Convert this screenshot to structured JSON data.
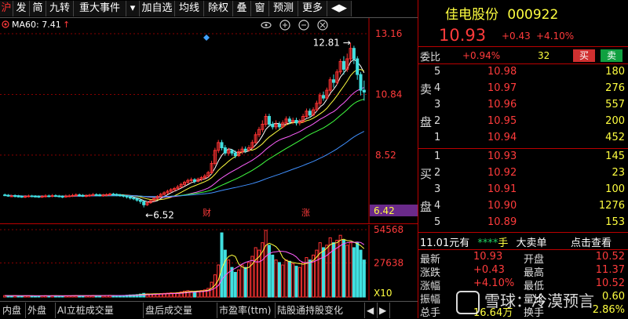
{
  "toolbar": {
    "items": [
      "沪",
      "发",
      "简",
      "九转",
      "重大事件",
      "▾",
      "加自选",
      "均线",
      "除权",
      "叠",
      "窗",
      "预测",
      "更多",
      "◀▶"
    ]
  },
  "indicator": {
    "icon": "target-icon",
    "ma60_label": "MA60: 7.41",
    "ma60_arrow": "↑"
  },
  "chart_icons": [
    "eye-icon",
    "plus-icon",
    "minus-icon",
    "close-icon"
  ],
  "chart_data": [
    {
      "type": "candlestick",
      "title": "",
      "y_ticks": [
        "13.16",
        "10.84",
        "8.52",
        "6.42"
      ],
      "ylim": [
        6.42,
        13.16
      ],
      "annotations": [
        {
          "text": "12.81",
          "kind": "high"
        },
        {
          "text": "6.52",
          "kind": "low"
        },
        {
          "text": "财",
          "kind": "event"
        },
        {
          "text": "涨",
          "kind": "event"
        }
      ],
      "series_colors": {
        "up": "#ff3333",
        "down": "#40e0e0",
        "ma5": "#ffffff",
        "ma10": "#ffff40",
        "ma20": "#ff60ff",
        "ma30": "#40ff40",
        "ma60": "#4090ff"
      },
      "candles": [
        [
          7.0,
          6.99,
          6.95,
          7.05
        ],
        [
          6.98,
          6.97,
          6.93,
          7.03
        ],
        [
          6.96,
          6.96,
          6.92,
          7.01
        ],
        [
          6.97,
          6.96,
          6.9,
          7.02
        ],
        [
          6.95,
          6.94,
          6.9,
          7.0
        ],
        [
          6.94,
          6.93,
          6.89,
          6.98
        ],
        [
          6.93,
          6.94,
          6.88,
          6.99
        ],
        [
          6.94,
          6.96,
          6.9,
          7.01
        ],
        [
          6.96,
          6.95,
          6.91,
          7.0
        ],
        [
          6.95,
          6.94,
          6.9,
          6.99
        ],
        [
          6.94,
          6.93,
          6.89,
          6.98
        ],
        [
          6.93,
          6.94,
          6.89,
          6.99
        ],
        [
          6.94,
          6.96,
          6.9,
          7.02
        ],
        [
          6.96,
          6.95,
          6.91,
          7.01
        ],
        [
          6.95,
          6.97,
          6.91,
          7.03
        ],
        [
          6.97,
          6.96,
          6.92,
          7.02
        ],
        [
          6.96,
          6.94,
          6.9,
          7.0
        ],
        [
          6.94,
          6.93,
          6.88,
          6.98
        ],
        [
          6.93,
          6.95,
          6.89,
          7.01
        ],
        [
          6.95,
          6.96,
          6.91,
          7.02
        ],
        [
          6.96,
          6.98,
          6.92,
          7.04
        ],
        [
          6.98,
          7.0,
          6.94,
          7.06
        ],
        [
          7.0,
          6.98,
          6.93,
          7.05
        ],
        [
          6.98,
          6.96,
          6.92,
          7.03
        ],
        [
          6.96,
          6.97,
          6.91,
          7.02
        ],
        [
          6.97,
          6.99,
          6.92,
          7.04
        ],
        [
          6.99,
          7.01,
          6.95,
          7.07
        ],
        [
          7.01,
          7.0,
          6.95,
          7.06
        ],
        [
          7.0,
          6.98,
          6.94,
          7.05
        ],
        [
          6.98,
          6.99,
          6.93,
          7.04
        ],
        [
          6.99,
          7.01,
          6.94,
          7.06
        ],
        [
          7.01,
          7.03,
          6.96,
          7.08
        ],
        [
          7.03,
          7.02,
          6.97,
          7.08
        ],
        [
          7.02,
          7.0,
          6.95,
          7.06
        ],
        [
          7.0,
          6.98,
          6.93,
          7.04
        ],
        [
          6.98,
          6.95,
          6.9,
          7.02
        ],
        [
          6.95,
          6.92,
          6.86,
          6.99
        ],
        [
          6.92,
          6.88,
          6.82,
          6.95
        ],
        [
          6.88,
          6.85,
          6.8,
          6.92
        ],
        [
          6.85,
          6.8,
          6.74,
          6.89
        ],
        [
          6.8,
          6.75,
          6.66,
          6.84
        ],
        [
          6.75,
          6.62,
          6.52,
          6.79
        ],
        [
          6.62,
          6.7,
          6.58,
          6.76
        ],
        [
          6.7,
          6.78,
          6.66,
          6.82
        ],
        [
          6.78,
          6.86,
          6.74,
          6.9
        ],
        [
          6.86,
          6.94,
          6.82,
          6.99
        ],
        [
          6.94,
          7.02,
          6.9,
          7.08
        ],
        [
          7.02,
          7.08,
          6.97,
          7.14
        ],
        [
          7.08,
          7.14,
          7.02,
          7.2
        ],
        [
          7.14,
          7.2,
          7.08,
          7.26
        ],
        [
          7.2,
          7.24,
          7.12,
          7.3
        ],
        [
          7.24,
          7.3,
          7.18,
          7.38
        ],
        [
          7.3,
          7.4,
          7.26,
          7.46
        ],
        [
          7.4,
          7.48,
          7.34,
          7.54
        ],
        [
          7.48,
          7.55,
          7.42,
          7.62
        ],
        [
          7.55,
          7.58,
          7.46,
          7.66
        ],
        [
          7.58,
          7.52,
          7.44,
          7.64
        ],
        [
          7.52,
          7.6,
          7.48,
          7.66
        ],
        [
          7.6,
          7.66,
          7.52,
          7.72
        ],
        [
          7.66,
          7.72,
          7.58,
          7.8
        ],
        [
          7.72,
          7.85,
          7.66,
          7.92
        ],
        [
          7.85,
          8.2,
          7.8,
          8.3
        ],
        [
          8.2,
          8.7,
          8.12,
          8.8
        ],
        [
          8.7,
          9.0,
          8.6,
          9.1
        ],
        [
          9.0,
          8.8,
          8.7,
          9.1
        ],
        [
          8.8,
          8.6,
          8.5,
          8.9
        ],
        [
          8.6,
          8.7,
          8.5,
          8.8
        ],
        [
          8.7,
          8.6,
          8.5,
          8.75
        ],
        [
          8.6,
          8.5,
          8.4,
          8.7
        ],
        [
          8.5,
          8.65,
          8.45,
          8.75
        ],
        [
          8.65,
          8.75,
          8.55,
          8.85
        ],
        [
          8.75,
          8.7,
          8.6,
          8.85
        ],
        [
          8.7,
          8.8,
          8.65,
          8.9
        ],
        [
          8.8,
          9.0,
          8.75,
          9.1
        ],
        [
          9.0,
          9.3,
          8.95,
          9.4
        ],
        [
          9.3,
          9.5,
          9.2,
          9.6
        ],
        [
          9.5,
          9.7,
          9.4,
          9.85
        ],
        [
          9.7,
          10.0,
          9.6,
          10.1
        ],
        [
          10.0,
          9.7,
          9.6,
          10.1
        ],
        [
          9.7,
          9.6,
          9.5,
          9.8
        ],
        [
          9.6,
          9.7,
          9.5,
          9.85
        ],
        [
          9.7,
          9.6,
          9.5,
          9.8
        ],
        [
          9.6,
          9.75,
          9.55,
          9.85
        ],
        [
          9.75,
          9.9,
          9.65,
          10.0
        ],
        [
          9.9,
          9.8,
          9.7,
          10.0
        ],
        [
          9.8,
          9.85,
          9.7,
          9.95
        ],
        [
          9.85,
          9.75,
          9.65,
          9.95
        ],
        [
          9.75,
          9.8,
          9.65,
          9.9
        ],
        [
          9.8,
          10.0,
          9.75,
          10.1
        ],
        [
          10.0,
          10.2,
          9.95,
          10.3
        ],
        [
          10.2,
          10.05,
          9.95,
          10.3
        ],
        [
          10.05,
          10.25,
          10.0,
          10.35
        ],
        [
          10.25,
          10.5,
          10.2,
          10.6
        ],
        [
          10.5,
          10.8,
          10.4,
          10.9
        ],
        [
          10.8,
          10.7,
          10.6,
          10.95
        ],
        [
          10.7,
          11.0,
          10.65,
          11.1
        ],
        [
          11.0,
          11.4,
          10.9,
          11.5
        ],
        [
          11.4,
          11.3,
          11.1,
          11.6
        ],
        [
          11.3,
          11.7,
          11.2,
          11.8
        ],
        [
          11.7,
          12.1,
          11.6,
          12.2
        ],
        [
          12.1,
          11.8,
          11.6,
          12.3
        ],
        [
          11.8,
          12.2,
          11.7,
          12.4
        ],
        [
          12.2,
          12.6,
          12.1,
          12.81
        ],
        [
          12.6,
          12.2,
          12.0,
          12.7
        ],
        [
          12.2,
          11.6,
          11.4,
          12.3
        ],
        [
          11.6,
          11.0,
          10.8,
          11.7
        ],
        [
          11.0,
          10.93,
          10.6,
          11.37
        ]
      ]
    },
    {
      "type": "bar",
      "title": "",
      "y_ticks": [
        "54568",
        "27638",
        "X10"
      ],
      "ylim": [
        0,
        54568
      ],
      "volumes": [
        1200,
        1100,
        1000,
        1150,
        980,
        900,
        1050,
        1100,
        1000,
        950,
        900,
        980,
        1100,
        1000,
        1150,
        1050,
        950,
        900,
        1050,
        1100,
        1200,
        1300,
        1150,
        1050,
        1100,
        1200,
        1350,
        1250,
        1150,
        1200,
        1300,
        1400,
        1300,
        1200,
        1150,
        1300,
        1500,
        1700,
        1800,
        2000,
        2400,
        3000,
        2600,
        2500,
        2400,
        2600,
        2800,
        3000,
        3200,
        3400,
        3300,
        3600,
        4200,
        4800,
        5200,
        4800,
        4500,
        4900,
        5300,
        5800,
        7000,
        12000,
        18000,
        26000,
        52000,
        38000,
        30000,
        24000,
        20000,
        22000,
        26000,
        24000,
        28000,
        33000,
        40000,
        38000,
        44000,
        54000,
        42000,
        34000,
        30000,
        28000,
        26000,
        30000,
        29000,
        27000,
        25000,
        24000,
        28000,
        32000,
        30000,
        34000,
        38000,
        44000,
        40000,
        42000,
        48000,
        44000,
        46000,
        50000,
        46000,
        42000,
        44000,
        40000,
        44000,
        38000,
        30000
      ],
      "volume_up": [
        true,
        false,
        false,
        true,
        false,
        false,
        true,
        true,
        false,
        false,
        false,
        true,
        true,
        false,
        true,
        false,
        false,
        false,
        true,
        true,
        true,
        true,
        false,
        false,
        true,
        true,
        true,
        false,
        false,
        true,
        true,
        true,
        false,
        false,
        false,
        false,
        false,
        false,
        false,
        false,
        false,
        false,
        true,
        true,
        true,
        true,
        true,
        true,
        true,
        true,
        true,
        true,
        true,
        true,
        true,
        true,
        false,
        true,
        true,
        true,
        true,
        true,
        true,
        true,
        false,
        false,
        true,
        false,
        false,
        true,
        true,
        false,
        true,
        true,
        true,
        true,
        true,
        true,
        false,
        false,
        true,
        false,
        true,
        true,
        false,
        true,
        false,
        true,
        true,
        true,
        false,
        true,
        true,
        true,
        false,
        true,
        true,
        false,
        true,
        true,
        false,
        true,
        true,
        false,
        false,
        false,
        false
      ]
    }
  ],
  "tabs": [
    "内盘",
    "外盘",
    "AI立桩成交量",
    "盘后成交量",
    "市盈率(ttm)",
    "陆股通持股变化",
    "◀",
    "▶"
  ],
  "quote": {
    "name": "佳电股份",
    "code": "000922",
    "price": "10.93",
    "change": "+0.43",
    "change_pct": "+4.10%",
    "weibi_label": "委比",
    "weibi": "+0.94%",
    "weicha": "32",
    "buy_btn": "买",
    "sell_btn": "卖",
    "sell_label_1": "卖",
    "sell_label_2": "盘",
    "buy_label_1": "买",
    "buy_label_2": "盘",
    "asks": [
      {
        "lvl": "5",
        "price": "10.98",
        "vol": "180"
      },
      {
        "lvl": "4",
        "price": "10.97",
        "vol": "276"
      },
      {
        "lvl": "3",
        "price": "10.96",
        "vol": "557"
      },
      {
        "lvl": "2",
        "price": "10.95",
        "vol": "200"
      },
      {
        "lvl": "1",
        "price": "10.94",
        "vol": "452"
      }
    ],
    "bids": [
      {
        "lvl": "1",
        "price": "10.93",
        "vol": "145"
      },
      {
        "lvl": "2",
        "price": "10.92",
        "vol": "23"
      },
      {
        "lvl": "3",
        "price": "10.91",
        "vol": "100"
      },
      {
        "lvl": "4",
        "price": "10.90",
        "vol": "1276"
      },
      {
        "lvl": "5",
        "price": "10.89",
        "vol": "153"
      }
    ],
    "bigorder": {
      "price": "11.01",
      "unit": "元有",
      "stars": "****",
      "hand": "手",
      "label": "大卖单",
      "link": "点击查看"
    },
    "stats": [
      {
        "l1": "最新",
        "v1": "10.93",
        "l2": "开盘",
        "v2": "10.52"
      },
      {
        "l1": "涨跌",
        "v1": "+0.43",
        "l2": "最高",
        "v2": "11.37"
      },
      {
        "l1": "涨幅",
        "v1": "+4.10%",
        "l2": "最低",
        "v2": "10.52"
      },
      {
        "l1": "振幅",
        "v1": "",
        "l2": "量比",
        "v2": "0.60"
      },
      {
        "l1": "总手",
        "v1": "16.64万",
        "l2": "换手",
        "v2": "2.86%"
      }
    ],
    "watermark": "雪球：冷漠预言"
  }
}
